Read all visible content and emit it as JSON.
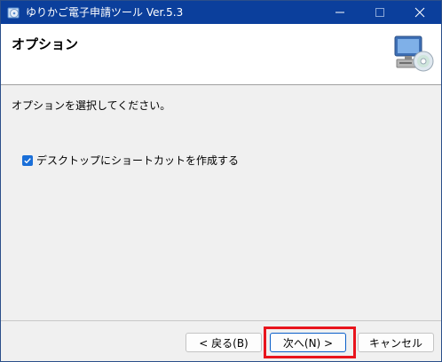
{
  "window": {
    "title": "ゆりかご電子申請ツール Ver.5.3"
  },
  "header": {
    "title": "オプション"
  },
  "main": {
    "instruction": "オプションを選択してください。",
    "checkbox": {
      "label": "デスクトップにショートカットを作成する",
      "checked": true
    }
  },
  "footer": {
    "back_label": "< 戻る(B)",
    "next_label": "次へ(N) >",
    "cancel_label": "キャンセル"
  },
  "icons": {
    "app": "installer-disc-icon",
    "header": "computer-disc-icon",
    "minimize": "minimize-icon",
    "maximize": "maximize-icon",
    "close": "close-icon"
  },
  "colors": {
    "titlebar": "#0b3f9c",
    "checkbox": "#1a6fd8",
    "highlight": "#e8141c"
  }
}
